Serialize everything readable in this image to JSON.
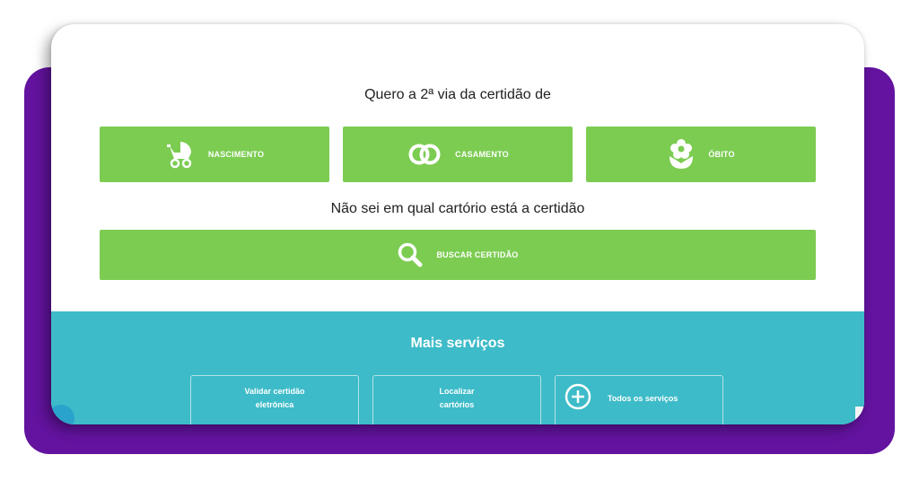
{
  "certificate_section": {
    "heading": "Quero a 2ª via da certidão de",
    "buttons": [
      {
        "label": "NASCIMENTO",
        "icon": "baby-stroller-icon"
      },
      {
        "label": "CASAMENTO",
        "icon": "rings-icon"
      },
      {
        "label": "ÓBITO",
        "icon": "flower-icon"
      }
    ]
  },
  "search_section": {
    "heading": "Não sei em qual cartório está a certidão",
    "button_label": "BUSCAR CERTIDÃO",
    "icon": "search-icon"
  },
  "more_services": {
    "title": "Mais serviços",
    "items": [
      {
        "line1": "Validar certidão",
        "line2": "eletrônica"
      },
      {
        "line1": "Localizar",
        "line2": "cartórios"
      },
      {
        "label": "Todos os serviços",
        "icon": "plus-circle-icon"
      }
    ]
  },
  "colors": {
    "purple": "#63139f",
    "green": "#7ccc52",
    "teal": "#3dbbc8"
  }
}
